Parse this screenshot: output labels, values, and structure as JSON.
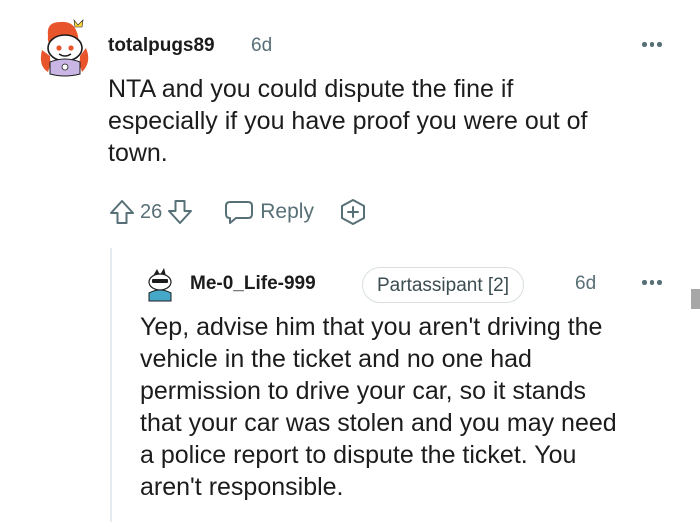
{
  "comments": [
    {
      "username": "totalpugs89",
      "time": "6d",
      "body": [
        "NTA and you could dispute the fine if",
        "especially if you have proof you were out of",
        "town."
      ],
      "score": "26",
      "reply_label": "Reply",
      "avatar": "snoo-avatar-icon"
    },
    {
      "username": "Me-0_Life-999",
      "flair": "Partassipant [2]",
      "time": "6d",
      "body": [
        "Yep, advise him that you aren't driving the",
        "vehicle in the ticket and no one had",
        "permission to drive your car, so it stands",
        "that your car was stolen and you may need",
        "a police report to dispute the ticket. You",
        "aren't responsible."
      ],
      "avatar": "snoo-avatar-icon"
    }
  ],
  "icons": {
    "upvote": "arrow-up-icon",
    "downvote": "arrow-down-icon",
    "reply": "speech-bubble-icon",
    "award": "award-plus-icon",
    "more": "ellipsis-icon"
  },
  "colors": {
    "text": "#1c1c1c",
    "meta": "#576f76",
    "border": "#d9dfe1",
    "thread_line": "#e5ebee"
  }
}
